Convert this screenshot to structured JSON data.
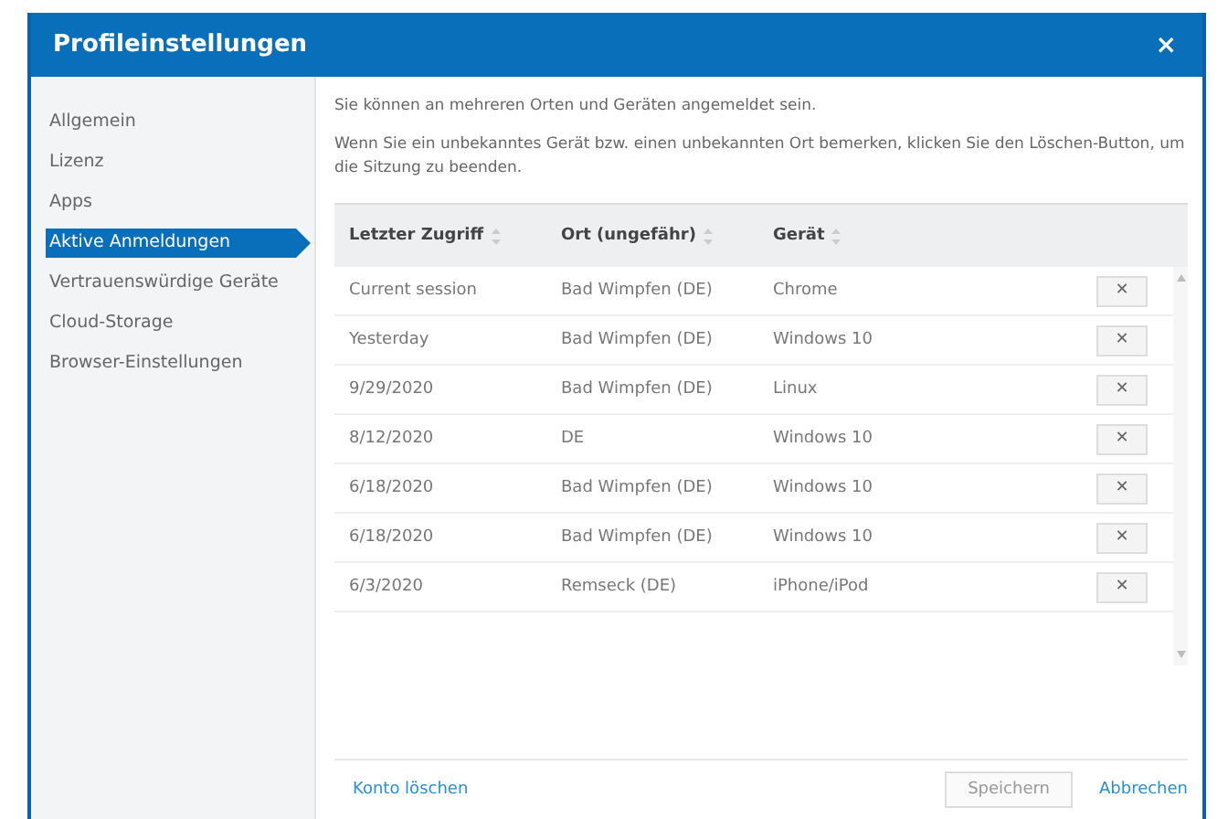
{
  "window": {
    "title": "Profileinstellungen",
    "close": "×"
  },
  "sidebar": {
    "items": [
      {
        "label": "Allgemein",
        "selected": false
      },
      {
        "label": "Lizenz",
        "selected": false
      },
      {
        "label": "Apps",
        "selected": false
      },
      {
        "label": "Aktive Anmeldungen",
        "selected": true
      },
      {
        "label": "Vertrauenswürdige Geräte",
        "selected": false
      },
      {
        "label": "Cloud-Storage",
        "selected": false
      },
      {
        "label": "Browser-Einstellungen",
        "selected": false
      }
    ]
  },
  "intro": [
    "Sie können an mehreren Orten und Geräten angemeldet sein.",
    "Wenn Sie ein unbekanntes Gerät bzw. einen unbekannten Ort bemerken, klicken Sie den Löschen-Button, um die Sitzung zu beenden."
  ],
  "table": {
    "columns": [
      "Letzter Zugriff",
      "Ort (ungefähr)",
      "Gerät"
    ],
    "rows": [
      {
        "cells": [
          "Current session",
          "Bad Wimpfen (DE)",
          "Chrome"
        ],
        "remove": "✕"
      },
      {
        "cells": [
          "Yesterday",
          "Bad Wimpfen (DE)",
          "Windows 10"
        ],
        "remove": "✕"
      },
      {
        "cells": [
          "9/29/2020",
          "Bad Wimpfen (DE)",
          "Linux"
        ],
        "remove": "✕"
      },
      {
        "cells": [
          "8/12/2020",
          "DE",
          "Windows 10"
        ],
        "remove": "✕"
      },
      {
        "cells": [
          "6/18/2020",
          "Bad Wimpfen (DE)",
          "Windows 10"
        ],
        "remove": "✕"
      },
      {
        "cells": [
          "6/18/2020",
          "Bad Wimpfen (DE)",
          "Windows 10"
        ],
        "remove": "✕"
      },
      {
        "cells": [
          "6/3/2020",
          "Remseck (DE)",
          "iPhone/iPod"
        ],
        "remove": "✕"
      }
    ]
  },
  "footer": {
    "delete_link": "Konto löschen",
    "save": {
      "label": "Speichern",
      "disabled": true
    },
    "cancel": "Abbrechen"
  }
}
